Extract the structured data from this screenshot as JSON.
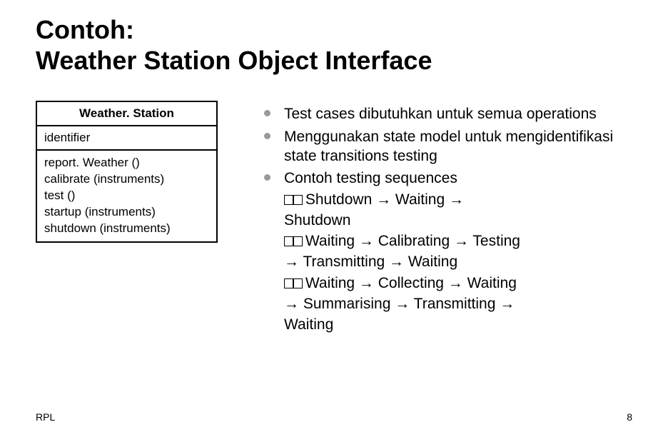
{
  "title_line1": "Contoh:",
  "title_line2": "Weather Station Object Interface",
  "uml": {
    "class_name": "Weather. Station",
    "attribute": "identifier",
    "operations": [
      "report. Weather ()",
      "calibrate (instruments)",
      "test ()",
      "startup (instruments)",
      "shutdown (instruments)"
    ]
  },
  "bullets": [
    "Test cases dibutuhkan untuk semua operations",
    "Menggunakan state model untuk mengidentifikasi state transitions testing",
    "Contoh testing sequences"
  ],
  "sequences": {
    "s1_a": "Shutdown → Waiting →",
    "s1_b": "Shutdown",
    "s2_a": "Waiting → Calibrating → Testing",
    "s2_b": "→ Transmitting → Waiting",
    "s3_a": "Waiting → Collecting → Waiting",
    "s3_b": "→ Summarising → Transmitting →",
    "s3_c": "Waiting"
  },
  "footer": {
    "left": "RPL",
    "right": "8"
  }
}
